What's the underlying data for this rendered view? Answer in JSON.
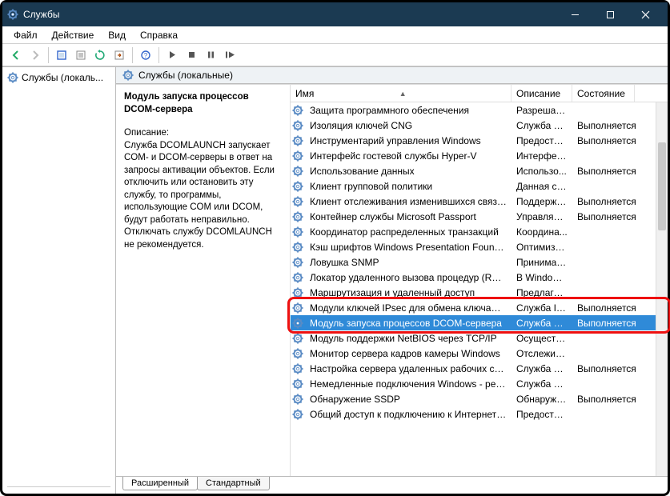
{
  "window": {
    "title": "Службы"
  },
  "menu": {
    "file": "Файл",
    "action": "Действие",
    "view": "Вид",
    "help": "Справка"
  },
  "tree": {
    "root": "Службы (локаль..."
  },
  "pane": {
    "header": "Службы (локальные)"
  },
  "tabs": {
    "extended": "Расширенный",
    "standard": "Стандартный"
  },
  "columns": {
    "name": "Имя",
    "description": "Описание",
    "state": "Состояние"
  },
  "detail": {
    "title": "Модуль запуска процессов DCOM-сервера",
    "desc_label": "Описание:",
    "desc_text": "Служба DCOMLAUNCH запускает COM- и DCOM-серверы в ответ на запросы активации объектов. Если отключить или остановить эту службу, то программы, использующие COM или DCOM, будут работать неправильно. Отключать службу DCOMLAUNCH не рекомендуется."
  },
  "services": [
    {
      "name": "Защита программного обеспечения",
      "desc": "Разрешает...",
      "state": ""
    },
    {
      "name": "Изоляция ключей CNG",
      "desc": "Служба из...",
      "state": "Выполняется"
    },
    {
      "name": "Инструментарий управления Windows",
      "desc": "Предостав...",
      "state": "Выполняется"
    },
    {
      "name": "Интерфейс гостевой службы Hyper-V",
      "desc": "Интерфей...",
      "state": ""
    },
    {
      "name": "Использование данных",
      "desc": "Использо...",
      "state": "Выполняется"
    },
    {
      "name": "Клиент групповой политики",
      "desc": "Данная сл...",
      "state": ""
    },
    {
      "name": "Клиент отслеживания изменившихся связей",
      "desc": "Поддержи...",
      "state": "Выполняется"
    },
    {
      "name": "Контейнер службы Microsoft Passport",
      "desc": "Управляет...",
      "state": "Выполняется"
    },
    {
      "name": "Координатор распределенных транзакций",
      "desc": "Координа...",
      "state": ""
    },
    {
      "name": "Кэш шрифтов Windows Presentation Foundatio...",
      "desc": "Оптимизи...",
      "state": ""
    },
    {
      "name": "Ловушка SNMP",
      "desc": "Принимае...",
      "state": ""
    },
    {
      "name": "Локатор удаленного вызова процедур (RPC)",
      "desc": "В Windows...",
      "state": ""
    },
    {
      "name": "Маршрутизация и удаленный доступ",
      "desc": "Предлагае...",
      "state": ""
    },
    {
      "name": "Модули ключей IPsec для обмена ключами в ...",
      "desc": "Служба IK...",
      "state": "Выполняется"
    },
    {
      "name": "Модуль запуска процессов DCOM-сервера",
      "desc": "Служба D...",
      "state": "Выполняется",
      "selected": true
    },
    {
      "name": "Модуль поддержки NetBIOS через TCP/IP",
      "desc": "Осуществ...",
      "state": ""
    },
    {
      "name": "Монитор сервера кадров камеры Windows",
      "desc": "Отслежив...",
      "state": ""
    },
    {
      "name": "Настройка сервера удаленных рабочих столов",
      "desc": "Служба на...",
      "state": "Выполняется"
    },
    {
      "name": "Немедленные подключения Windows - регист...",
      "desc": "Служба W...",
      "state": ""
    },
    {
      "name": "Обнаружение SSDP",
      "desc": "Обнаружи...",
      "state": "Выполняется"
    },
    {
      "name": "Общий доступ к подключению к Интернету (I...",
      "desc": "Предостав...",
      "state": ""
    }
  ]
}
